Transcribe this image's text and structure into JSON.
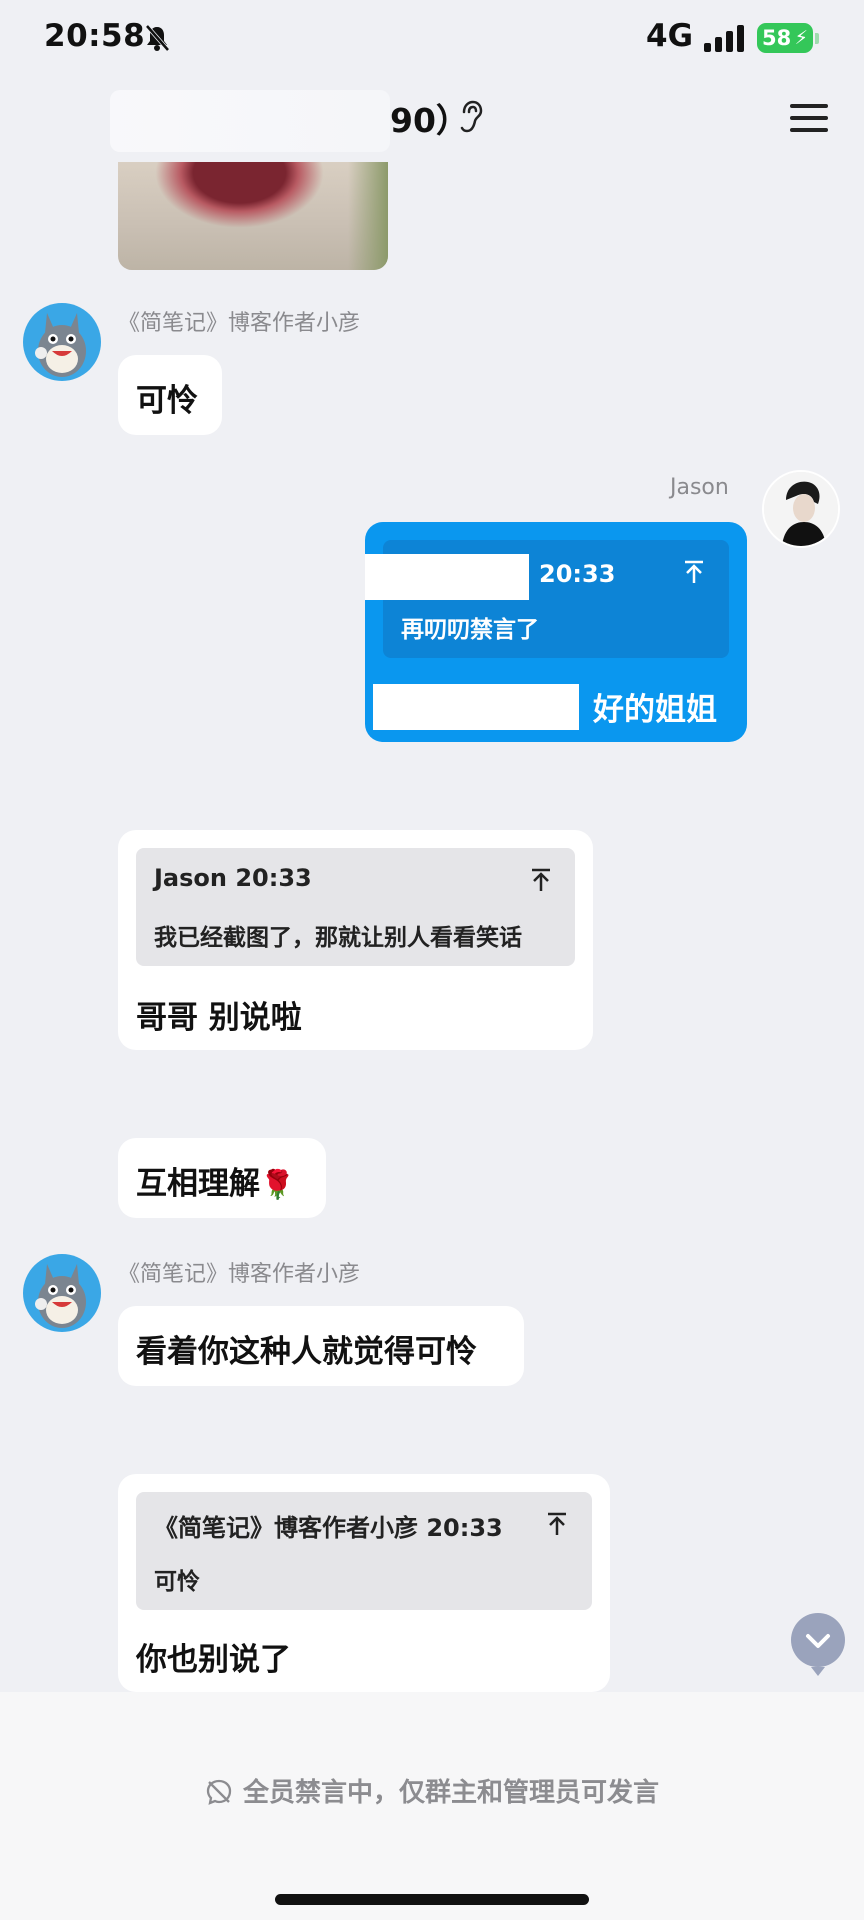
{
  "status_bar": {
    "time": "20:58",
    "network": "4G",
    "battery": "58"
  },
  "header": {
    "title_fragment": "90）"
  },
  "messages": [
    {
      "type": "text",
      "sender": "《简笔记》博客作者小彦",
      "text": "可怜"
    },
    {
      "type": "reply",
      "sender": "Jason",
      "quote_time": "20:33",
      "quote_text": "再叨叨禁言了",
      "text": "好的姐姐"
    },
    {
      "type": "reply",
      "quote_header": "Jason 20:33",
      "quote_text": "我已经截图了，那就让别人看看笑话",
      "text": "哥哥 别说啦"
    },
    {
      "type": "text",
      "text": "互相理解",
      "emoji": "🌹"
    },
    {
      "type": "text",
      "sender": "《简笔记》博客作者小彦",
      "text": "看着你这种人就觉得可怜"
    },
    {
      "type": "reply",
      "quote_header": "《简笔记》博客作者小彦 20:33",
      "quote_text": "可怜",
      "text": "你也别说了"
    }
  ],
  "footer": {
    "notice": "全员禁言中，仅群主和管理员可发言"
  },
  "colors": {
    "accent": "#0a97ef",
    "background": "#eff0f4"
  }
}
